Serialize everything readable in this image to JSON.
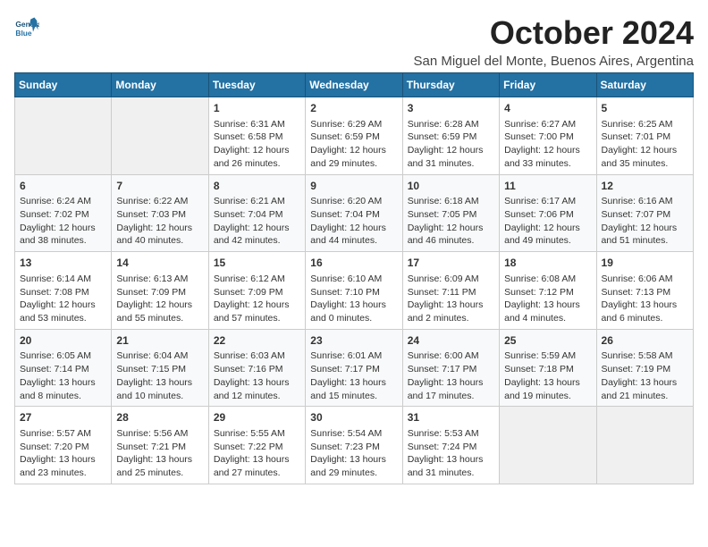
{
  "logo": {
    "line1": "General",
    "line2": "Blue"
  },
  "title": "October 2024",
  "subtitle": "San Miguel del Monte, Buenos Aires, Argentina",
  "days_header": [
    "Sunday",
    "Monday",
    "Tuesday",
    "Wednesday",
    "Thursday",
    "Friday",
    "Saturday"
  ],
  "weeks": [
    [
      {
        "day": "",
        "info": ""
      },
      {
        "day": "",
        "info": ""
      },
      {
        "day": "1",
        "info": "Sunrise: 6:31 AM\nSunset: 6:58 PM\nDaylight: 12 hours\nand 26 minutes."
      },
      {
        "day": "2",
        "info": "Sunrise: 6:29 AM\nSunset: 6:59 PM\nDaylight: 12 hours\nand 29 minutes."
      },
      {
        "day": "3",
        "info": "Sunrise: 6:28 AM\nSunset: 6:59 PM\nDaylight: 12 hours\nand 31 minutes."
      },
      {
        "day": "4",
        "info": "Sunrise: 6:27 AM\nSunset: 7:00 PM\nDaylight: 12 hours\nand 33 minutes."
      },
      {
        "day": "5",
        "info": "Sunrise: 6:25 AM\nSunset: 7:01 PM\nDaylight: 12 hours\nand 35 minutes."
      }
    ],
    [
      {
        "day": "6",
        "info": "Sunrise: 6:24 AM\nSunset: 7:02 PM\nDaylight: 12 hours\nand 38 minutes."
      },
      {
        "day": "7",
        "info": "Sunrise: 6:22 AM\nSunset: 7:03 PM\nDaylight: 12 hours\nand 40 minutes."
      },
      {
        "day": "8",
        "info": "Sunrise: 6:21 AM\nSunset: 7:04 PM\nDaylight: 12 hours\nand 42 minutes."
      },
      {
        "day": "9",
        "info": "Sunrise: 6:20 AM\nSunset: 7:04 PM\nDaylight: 12 hours\nand 44 minutes."
      },
      {
        "day": "10",
        "info": "Sunrise: 6:18 AM\nSunset: 7:05 PM\nDaylight: 12 hours\nand 46 minutes."
      },
      {
        "day": "11",
        "info": "Sunrise: 6:17 AM\nSunset: 7:06 PM\nDaylight: 12 hours\nand 49 minutes."
      },
      {
        "day": "12",
        "info": "Sunrise: 6:16 AM\nSunset: 7:07 PM\nDaylight: 12 hours\nand 51 minutes."
      }
    ],
    [
      {
        "day": "13",
        "info": "Sunrise: 6:14 AM\nSunset: 7:08 PM\nDaylight: 12 hours\nand 53 minutes."
      },
      {
        "day": "14",
        "info": "Sunrise: 6:13 AM\nSunset: 7:09 PM\nDaylight: 12 hours\nand 55 minutes."
      },
      {
        "day": "15",
        "info": "Sunrise: 6:12 AM\nSunset: 7:09 PM\nDaylight: 12 hours\nand 57 minutes."
      },
      {
        "day": "16",
        "info": "Sunrise: 6:10 AM\nSunset: 7:10 PM\nDaylight: 13 hours\nand 0 minutes."
      },
      {
        "day": "17",
        "info": "Sunrise: 6:09 AM\nSunset: 7:11 PM\nDaylight: 13 hours\nand 2 minutes."
      },
      {
        "day": "18",
        "info": "Sunrise: 6:08 AM\nSunset: 7:12 PM\nDaylight: 13 hours\nand 4 minutes."
      },
      {
        "day": "19",
        "info": "Sunrise: 6:06 AM\nSunset: 7:13 PM\nDaylight: 13 hours\nand 6 minutes."
      }
    ],
    [
      {
        "day": "20",
        "info": "Sunrise: 6:05 AM\nSunset: 7:14 PM\nDaylight: 13 hours\nand 8 minutes."
      },
      {
        "day": "21",
        "info": "Sunrise: 6:04 AM\nSunset: 7:15 PM\nDaylight: 13 hours\nand 10 minutes."
      },
      {
        "day": "22",
        "info": "Sunrise: 6:03 AM\nSunset: 7:16 PM\nDaylight: 13 hours\nand 12 minutes."
      },
      {
        "day": "23",
        "info": "Sunrise: 6:01 AM\nSunset: 7:17 PM\nDaylight: 13 hours\nand 15 minutes."
      },
      {
        "day": "24",
        "info": "Sunrise: 6:00 AM\nSunset: 7:17 PM\nDaylight: 13 hours\nand 17 minutes."
      },
      {
        "day": "25",
        "info": "Sunrise: 5:59 AM\nSunset: 7:18 PM\nDaylight: 13 hours\nand 19 minutes."
      },
      {
        "day": "26",
        "info": "Sunrise: 5:58 AM\nSunset: 7:19 PM\nDaylight: 13 hours\nand 21 minutes."
      }
    ],
    [
      {
        "day": "27",
        "info": "Sunrise: 5:57 AM\nSunset: 7:20 PM\nDaylight: 13 hours\nand 23 minutes."
      },
      {
        "day": "28",
        "info": "Sunrise: 5:56 AM\nSunset: 7:21 PM\nDaylight: 13 hours\nand 25 minutes."
      },
      {
        "day": "29",
        "info": "Sunrise: 5:55 AM\nSunset: 7:22 PM\nDaylight: 13 hours\nand 27 minutes."
      },
      {
        "day": "30",
        "info": "Sunrise: 5:54 AM\nSunset: 7:23 PM\nDaylight: 13 hours\nand 29 minutes."
      },
      {
        "day": "31",
        "info": "Sunrise: 5:53 AM\nSunset: 7:24 PM\nDaylight: 13 hours\nand 31 minutes."
      },
      {
        "day": "",
        "info": ""
      },
      {
        "day": "",
        "info": ""
      }
    ]
  ]
}
